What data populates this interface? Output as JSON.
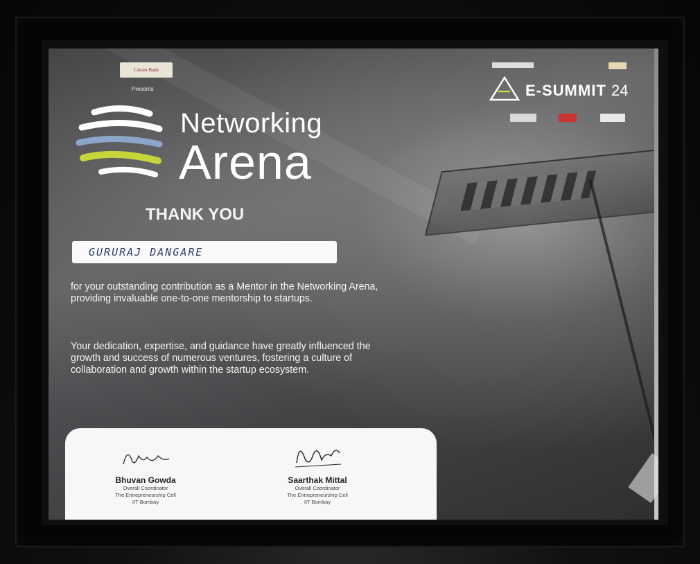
{
  "sponsor": {
    "logo_text": "Canara Bank",
    "presents": "Presents"
  },
  "event": {
    "title_line1": "Networking",
    "title_line2": "Arena",
    "esummit_title": "E-SUMMIT",
    "esummit_year": "24"
  },
  "certificate": {
    "heading": "THANK YOU",
    "recipient_name": "GURURAJ  DANGARE",
    "paragraph_1": "for your outstanding contribution as a Mentor in the Networking Arena, providing invaluable one-to-one mentorship to startups.",
    "paragraph_2": "Your dedication, expertise, and guidance have greatly influenced the growth and success of numerous ventures, fostering a culture of collaboration and growth within the startup ecosystem."
  },
  "signatories": [
    {
      "name": "Bhuvan Gowda",
      "role": "Overall Coordinator",
      "org": "The Entrepreneurship Cell",
      "institute": "IIT Bombay"
    },
    {
      "name": "Saarthak Mittal",
      "role": "Overall Coordinator",
      "org": "The Entrepreneurship Cell",
      "institute": "IIT Bombay"
    }
  ],
  "colors": {
    "emblem_lime": "#c6d63a",
    "emblem_blue": "#8aa6c8",
    "name_ink": "#2a3b6b"
  }
}
